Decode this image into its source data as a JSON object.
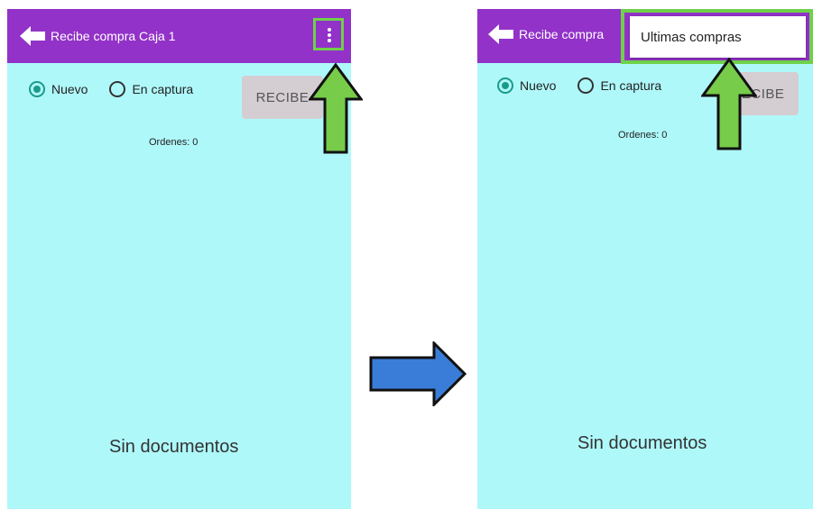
{
  "left_screen": {
    "appbar": {
      "title": "Recibe compra Caja 1",
      "back_icon": "arrow-left-icon",
      "menu_icon": "more-vert-icon"
    },
    "radios": [
      {
        "label": "Nuevo",
        "checked": true
      },
      {
        "label": "En captura",
        "checked": false
      }
    ],
    "recibe_button": "RECIBE",
    "ordenes": "Ordenes: 0",
    "empty_message": "Sin documentos"
  },
  "right_screen": {
    "appbar": {
      "title": "Recibe compra",
      "back_icon": "arrow-left-icon"
    },
    "radios": [
      {
        "label": "Nuevo",
        "checked": true
      },
      {
        "label": "En captura",
        "checked": false
      }
    ],
    "recibe_button": "RECIBE",
    "ordenes": "Ordenes: 0",
    "empty_message": "Sin documentos",
    "menu": {
      "items": [
        "Ultimas compras"
      ]
    }
  },
  "annotations": {
    "highlight_color": "#6fd14a",
    "pointer_arrows": [
      "arrow-up-icon",
      "arrow-up-icon"
    ],
    "transition_arrow": "arrow-right-icon",
    "transition_color": "#3a7dd8"
  },
  "theme": {
    "appbar_color": "#9232c8",
    "background_color": "#aff8fa",
    "accent_color": "#1a9b8a"
  }
}
